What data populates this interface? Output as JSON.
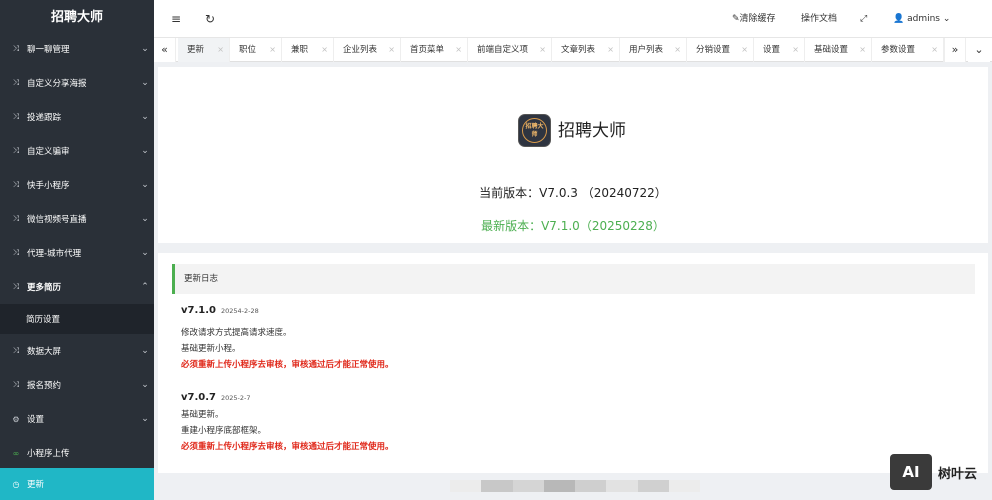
{
  "app": {
    "title": "招聘大师"
  },
  "sidebar": {
    "items": [
      {
        "label": "聊一聊管理",
        "icon": "shuffle-icon"
      },
      {
        "label": "自定义分享海报",
        "icon": "shuffle-icon"
      },
      {
        "label": "投递跟踪",
        "icon": "shuffle-icon"
      },
      {
        "label": "自定义骗审",
        "icon": "shuffle-icon"
      },
      {
        "label": "快手小程序",
        "icon": "shuffle-icon"
      },
      {
        "label": "微信视频号直播",
        "icon": "shuffle-icon"
      },
      {
        "label": "代理-城市代理",
        "icon": "shuffle-icon"
      },
      {
        "label": "更多简历",
        "icon": "shuffle-icon",
        "expanded": true
      },
      {
        "label": "数据大屏",
        "icon": "shuffle-icon"
      },
      {
        "label": "报名预约",
        "icon": "shuffle-icon"
      },
      {
        "label": "设置",
        "icon": "gear-icon"
      },
      {
        "label": "小程序上传",
        "icon": "link-icon"
      },
      {
        "label": "更新",
        "icon": "clock-icon",
        "active": true
      }
    ],
    "submenu": {
      "label": "简历设置"
    }
  },
  "header": {
    "menu_toggle_icon": "≡",
    "refresh_icon": "↻",
    "clear_cache": "清除缓存",
    "docs": "操作文档",
    "fullscreen_icon": "⤢",
    "user": "admins"
  },
  "tabs": [
    {
      "label": "更新",
      "active": true
    },
    {
      "label": "职位"
    },
    {
      "label": "兼职"
    },
    {
      "label": "企业列表"
    },
    {
      "label": "首页菜单"
    },
    {
      "label": "前端自定义项"
    },
    {
      "label": "文章列表"
    },
    {
      "label": "用户列表"
    },
    {
      "label": "分销设置"
    },
    {
      "label": "设置"
    },
    {
      "label": "基础设置"
    },
    {
      "label": "参数设置"
    }
  ],
  "version": {
    "app_name": "招聘大师",
    "logo_text": "招聘大师",
    "current": "当前版本：V7.0.3 （20240722）",
    "latest": "最新版本：V7.1.0（20250228）"
  },
  "changelog": {
    "title": "更新日志",
    "entries": [
      {
        "version": "v7.1.0",
        "date": "20254-2-28",
        "lines": [
          "修改请求方式提高请求速度。",
          "基础更新小程。"
        ],
        "warning": "必须重新上传小程序去审核，审核通过后才能正常使用。"
      },
      {
        "version": "v7.0.7",
        "date": "2025-2-7",
        "lines": [
          "基础更新。",
          "重建小程序底部框架。"
        ],
        "warning": "必须重新上传小程序去审核，审核通过后才能正常使用。"
      }
    ]
  },
  "watermark": {
    "badge": "AI",
    "text": "树叶云"
  },
  "colors": {
    "sidebar_bg": "#2a3038",
    "active_menu": "#20b7c6",
    "success": "#4caf50",
    "warning": "#e0291b"
  }
}
